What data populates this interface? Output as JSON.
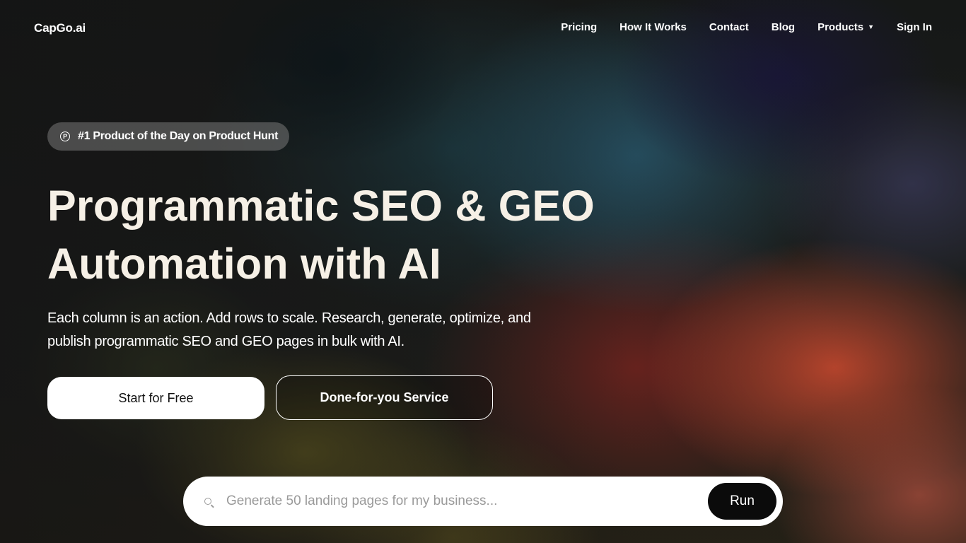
{
  "brand": {
    "logo_text": "CapGo.ai"
  },
  "nav": {
    "items": [
      {
        "label": "Pricing"
      },
      {
        "label": "How It Works"
      },
      {
        "label": "Contact"
      },
      {
        "label": "Blog"
      },
      {
        "label": "Products",
        "has_dropdown": true
      },
      {
        "label": "Sign In"
      }
    ]
  },
  "hero": {
    "badge": {
      "icon": "product-hunt-icon",
      "text": "#1 Product of the Day on Product Hunt"
    },
    "headline_line1": "Programmatic SEO & GEO",
    "headline_line2": "Automation with AI",
    "subtext": "Each column is an action. Add rows to scale. Research, generate, optimize, and publish programmatic SEO and GEO pages in bulk with AI.",
    "primary_button": "Start for Free",
    "secondary_button": "Done-for-you Service"
  },
  "search": {
    "placeholder": "Generate 50 landing pages for my business...",
    "value": "",
    "run_label": "Run"
  },
  "colors": {
    "headline": "#f6f0e6",
    "primary_button_bg": "#ffffff",
    "run_button_bg": "#0b0b0b"
  }
}
